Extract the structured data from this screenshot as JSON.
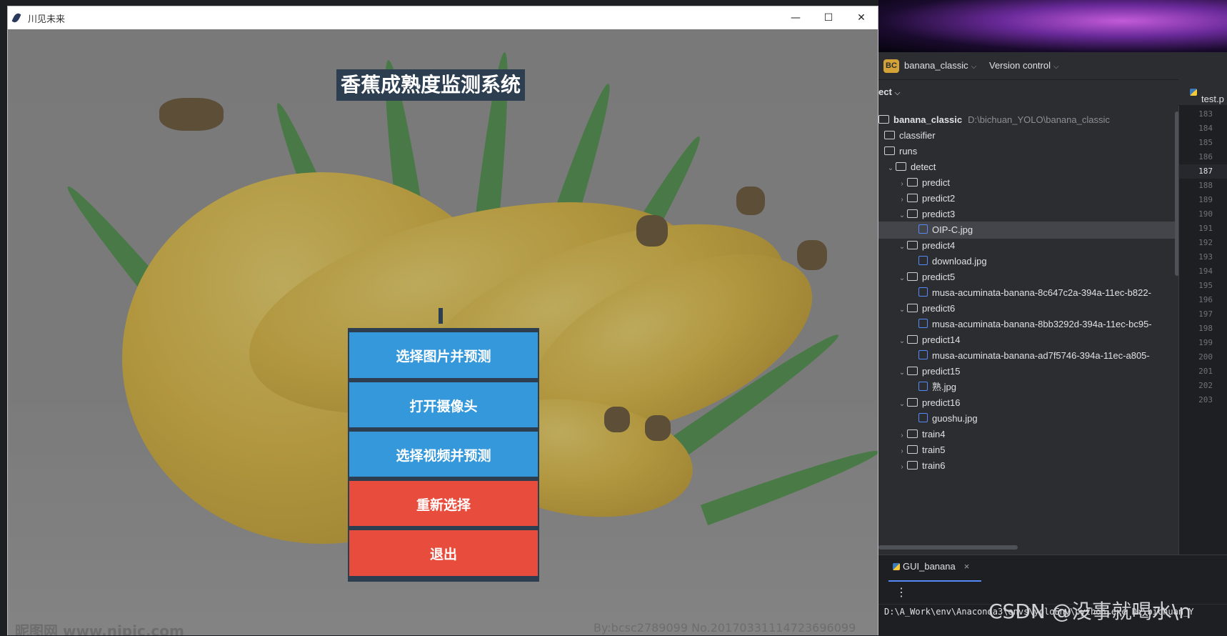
{
  "window": {
    "title": "川见未来",
    "minimize_glyph": "—",
    "maximize_glyph": "☐",
    "close_glyph": "✕"
  },
  "app": {
    "title": "香蕉成熟度监测系统",
    "buttons": [
      {
        "label": "选择图片并预测",
        "color": "#3498db"
      },
      {
        "label": "打开摄像头",
        "color": "#3498db"
      },
      {
        "label": "选择视频并预测",
        "color": "#3498db"
      },
      {
        "label": "重新选择",
        "color": "#e74c3c"
      },
      {
        "label": "退出",
        "color": "#e74c3c"
      }
    ],
    "title_bg": "#2c3e50",
    "watermark_left": "昵图网 www.nipic.com",
    "watermark_right": "By:bcsc2789099 No.20170331114723696099"
  },
  "ide": {
    "project_badge": "BC",
    "project_name": "banana_classic",
    "vcs_label": "Version control",
    "panel_header": "ect",
    "editor_tab": "test.p",
    "tree": [
      {
        "label": "banana_classic",
        "path": "D:\\bichuan_YOLO\\banana_classic",
        "kind": "root"
      },
      {
        "label": "classifier",
        "kind": "folder"
      },
      {
        "label": "runs",
        "kind": "folder"
      },
      {
        "label": "detect",
        "kind": "folder",
        "open": true
      },
      {
        "label": "predict",
        "kind": "folder",
        "depth": 1
      },
      {
        "label": "predict2",
        "kind": "folder",
        "depth": 1
      },
      {
        "label": "predict3",
        "kind": "folder",
        "depth": 1,
        "open": true
      },
      {
        "label": "OIP-C.jpg",
        "kind": "image",
        "selected": true
      },
      {
        "label": "predict4",
        "kind": "folder",
        "depth": 1,
        "open": true
      },
      {
        "label": "download.jpg",
        "kind": "image"
      },
      {
        "label": "predict5",
        "kind": "folder",
        "depth": 1,
        "open": true
      },
      {
        "label": "musa-acuminata-banana-8c647c2a-394a-11ec-b822-",
        "kind": "image"
      },
      {
        "label": "predict6",
        "kind": "folder",
        "depth": 1,
        "open": true
      },
      {
        "label": "musa-acuminata-banana-8bb3292d-394a-11ec-bc95-",
        "kind": "image"
      },
      {
        "label": "predict14",
        "kind": "folder",
        "depth": 1,
        "open": true
      },
      {
        "label": "musa-acuminata-banana-ad7f5746-394a-11ec-a805-",
        "kind": "image"
      },
      {
        "label": "predict15",
        "kind": "folder",
        "depth": 1,
        "open": true
      },
      {
        "label": "熟.jpg",
        "kind": "image"
      },
      {
        "label": "predict16",
        "kind": "folder",
        "depth": 1,
        "open": true
      },
      {
        "label": "guoshu.jpg",
        "kind": "image"
      },
      {
        "label": "train4",
        "kind": "folder",
        "depth": 1
      },
      {
        "label": "train5",
        "kind": "folder",
        "depth": 1
      },
      {
        "label": "train6",
        "kind": "folder",
        "depth": 1
      }
    ],
    "line_numbers": [
      "183",
      "184",
      "185",
      "186",
      "187",
      "188",
      "189",
      "190",
      "191",
      "192",
      "193",
      "194",
      "195",
      "196",
      "197",
      "198",
      "199",
      "200",
      "201",
      "202",
      "203"
    ],
    "current_line": "187",
    "run_tab": "GUI_banana",
    "run_close_glyph": "×",
    "kebab_glyph": "⋮",
    "console_line": "D:\\A_Work\\env\\Anaconda3\\envs\\yoloEnv\\python.exe D:\\bichuan_Y",
    "accent": "#548af7"
  },
  "overlay": {
    "csdn_watermark": "CSDN @没事就喝水\\n"
  }
}
